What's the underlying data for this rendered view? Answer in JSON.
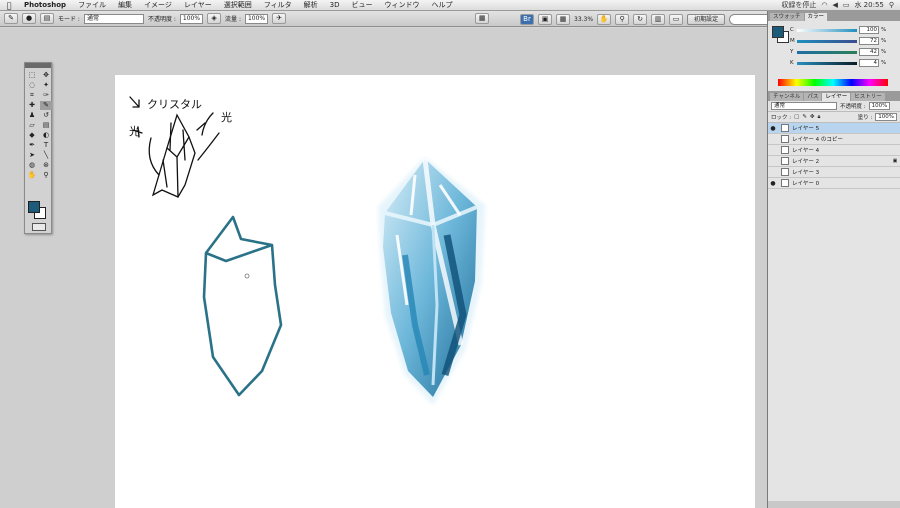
{
  "menubar": {
    "apple": "",
    "app_name": "Photoshop",
    "items": [
      "ファイル",
      "編集",
      "イメージ",
      "レイヤー",
      "選択範囲",
      "フィルタ",
      "解析",
      "3D",
      "ビュー",
      "ウィンドウ",
      "ヘルプ"
    ],
    "status_text": "収録を停止",
    "clock": "水 20:55"
  },
  "options_bar": {
    "mode_label": "モード :",
    "mode_value": "通常",
    "opacity_label": "不透明度 :",
    "opacity_value": "100%",
    "flow_label": "流量 :",
    "flow_value": "100%"
  },
  "app_bar": {
    "zoom": "33.3%",
    "workspace_button": "初期設定"
  },
  "panels": {
    "color_tabs": [
      "スウォッチ",
      "カラー"
    ],
    "cmyk": [
      {
        "channel": "C",
        "value": "100",
        "color": "#1f8fbf"
      },
      {
        "channel": "M",
        "value": "72",
        "color": "#c23a7e"
      },
      {
        "channel": "Y",
        "value": "42",
        "color": "#c8b92c"
      },
      {
        "channel": "K",
        "value": "4",
        "color": "#333333"
      }
    ],
    "layer_tabs": [
      "チャンネル",
      "パス",
      "レイヤー",
      "ヒストリー"
    ],
    "blend_mode": "通常",
    "opacity_label": "不透明度 :",
    "opacity_value": "100%",
    "lock_label": "ロック :",
    "fill_label": "塗り :",
    "fill_value": "100%",
    "layers": [
      {
        "name": "レイヤー 5",
        "visible": true,
        "selected": true,
        "locked": false
      },
      {
        "name": "レイヤー 4 のコピー",
        "visible": false,
        "selected": false,
        "locked": false
      },
      {
        "name": "レイヤー 4",
        "visible": false,
        "selected": false,
        "locked": false
      },
      {
        "name": "レイヤー 2",
        "visible": false,
        "selected": false,
        "locked": true
      },
      {
        "name": "レイヤー 3",
        "visible": false,
        "selected": false,
        "locked": false
      },
      {
        "name": "レイヤー 0",
        "visible": true,
        "selected": false,
        "locked": false
      }
    ]
  },
  "canvas": {
    "sketch_label": "クリスタル",
    "light_label": "光"
  },
  "colors": {
    "foreground": "#1d5b7a",
    "background": "#ffffff",
    "outline_stroke": "#2a7288"
  }
}
